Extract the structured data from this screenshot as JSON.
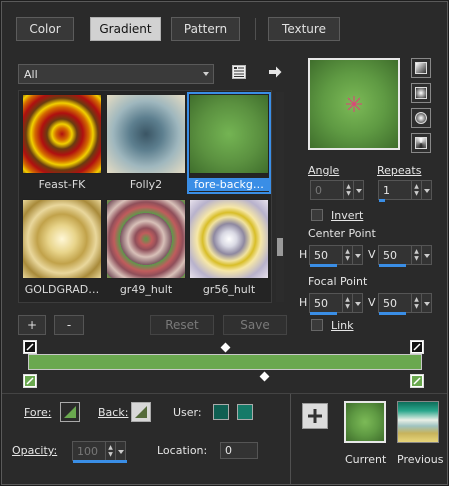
{
  "tabs": [
    {
      "label": "Color",
      "active": false
    },
    {
      "label": "Gradient",
      "active": true
    },
    {
      "label": "Pattern",
      "active": false
    },
    {
      "label": "Texture",
      "active": false
    }
  ],
  "category": {
    "selected": "All"
  },
  "gradients": [
    {
      "label": "Feast-FK",
      "selected": false
    },
    {
      "label": "Folly2",
      "selected": false
    },
    {
      "label": "fore-backg…",
      "selected": true
    },
    {
      "label": "GOLDGRAD…",
      "selected": false
    },
    {
      "label": "gr49_hult",
      "selected": false
    },
    {
      "label": "gr56_hult",
      "selected": false
    }
  ],
  "buttons": {
    "add": "+",
    "remove": "-",
    "reset": "Reset",
    "save": "Save"
  },
  "angle": {
    "label": "Angle",
    "value": "0"
  },
  "repeats": {
    "label": "Repeats",
    "value": "1"
  },
  "invert": {
    "label": "Invert",
    "checked": false
  },
  "center_point": {
    "label": "Center Point",
    "h_label": "H",
    "h": "50",
    "v_label": "V",
    "v": "50"
  },
  "focal_point": {
    "label": "Focal Point",
    "h_label": "H",
    "h": "50",
    "v_label": "V",
    "v": "50"
  },
  "link": {
    "label": "Link",
    "checked": false
  },
  "bottom": {
    "fore_label": "Fore:",
    "back_label": "Back:",
    "user_label": "User:",
    "opacity_label": "Opacity:",
    "opacity_value": "100",
    "location_label": "Location:",
    "location_value": "0",
    "current_label": "Current",
    "previous_label": "Previous"
  },
  "colors": {
    "accent": "#3a8ee6",
    "gradient_bar": "#6aa84f",
    "user1": "#0f5f52",
    "user2": "#157a68"
  }
}
